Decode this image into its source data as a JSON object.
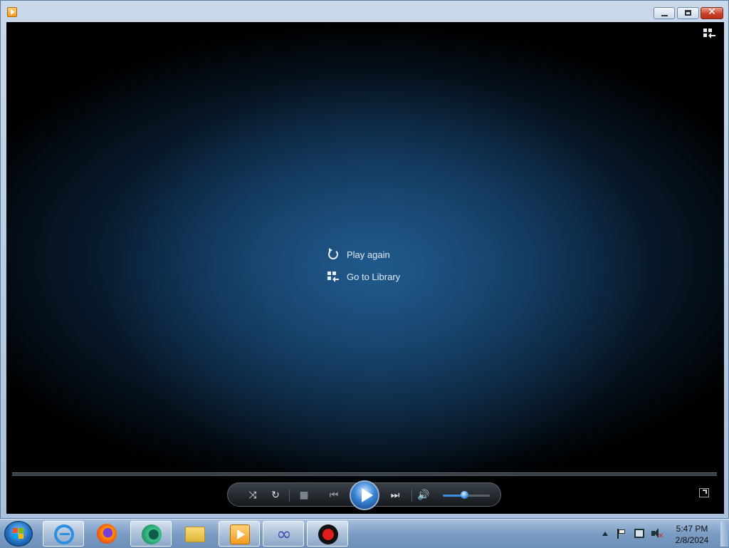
{
  "window": {
    "title": "",
    "controls": {
      "minimize": "–",
      "restore": "□",
      "close": "✕"
    }
  },
  "center_menu": {
    "play_again": "Play again",
    "go_to_library": "Go to Library"
  },
  "playback": {
    "volume_level": 0.5,
    "buttons": [
      "shuffle",
      "repeat",
      "stop",
      "previous",
      "play",
      "next",
      "mute",
      "volume"
    ]
  },
  "taskbar": {
    "apps": [
      {
        "name": "internet-explorer"
      },
      {
        "name": "firefox"
      },
      {
        "name": "app-green"
      },
      {
        "name": "file-explorer"
      },
      {
        "name": "windows-media-player"
      },
      {
        "name": "app-infinity"
      },
      {
        "name": "screen-recorder"
      }
    ],
    "clock": {
      "time": "5:47 PM",
      "date": "2/8/2024"
    }
  },
  "colors": {
    "accent": "#2f7fd2",
    "stage_bg": "#0d2a48"
  }
}
